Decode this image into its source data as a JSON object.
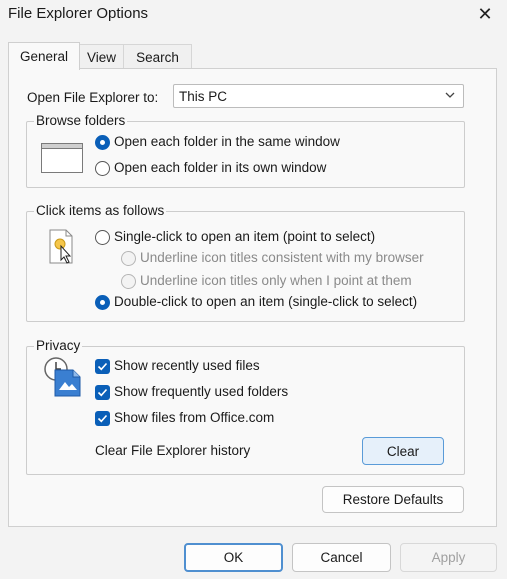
{
  "window": {
    "title": "File Explorer Options",
    "close_icon": "close-icon"
  },
  "tabs": [
    {
      "label": "General"
    },
    {
      "label": "View"
    },
    {
      "label": "Search"
    }
  ],
  "general": {
    "open_label": "Open File Explorer to:",
    "open_value": "This PC"
  },
  "browse": {
    "legend": "Browse folders",
    "options": [
      {
        "label": "Open each folder in the same window",
        "selected": true
      },
      {
        "label": "Open each folder in its own window",
        "selected": false
      }
    ]
  },
  "click": {
    "legend": "Click items as follows",
    "single": "Single-click to open an item (point to select)",
    "sub1": "Underline icon titles consistent with my browser",
    "sub2": "Underline icon titles only when I point at them",
    "double": "Double-click to open an item (single-click to select)"
  },
  "privacy": {
    "legend": "Privacy",
    "checks": [
      {
        "label": "Show recently used files",
        "checked": true
      },
      {
        "label": "Show frequently used folders",
        "checked": true
      },
      {
        "label": "Show files from Office.com",
        "checked": true
      }
    ],
    "clear_label": "Clear File Explorer history",
    "clear_button": "Clear"
  },
  "restore_button": "Restore Defaults",
  "footer": {
    "ok": "OK",
    "cancel": "Cancel",
    "apply": "Apply"
  },
  "colors": {
    "accent": "#0a5fb8",
    "panel": "#f9f9f9",
    "window": "#f3f3f3"
  }
}
